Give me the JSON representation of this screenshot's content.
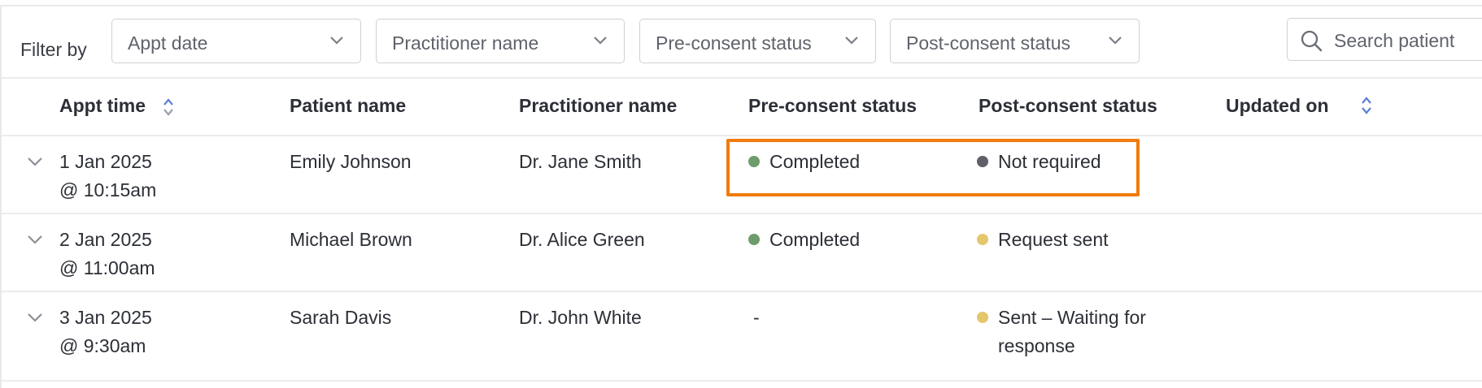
{
  "filter_bar": {
    "label": "Filter by",
    "dropdowns": [
      {
        "label": "Appt date"
      },
      {
        "label": "Practitioner name"
      },
      {
        "label": "Pre-consent status"
      },
      {
        "label": "Post-consent status"
      }
    ],
    "search": {
      "placeholder": "Search patient"
    }
  },
  "table": {
    "columns": [
      "Appt time",
      "Patient name",
      "Practitioner name",
      "Pre-consent status",
      "Post-consent status",
      "Updated on"
    ],
    "rows": [
      {
        "date": "1 Jan 2025",
        "time": "@ 10:15am",
        "patient": "Emily Johnson",
        "practitioner": "Dr. Jane Smith",
        "pre_status": "Completed",
        "pre_color": "#6e9c6b",
        "post_status": "Not required",
        "post_status_line2": "",
        "post_color": "#5f6068"
      },
      {
        "date": "2 Jan 2025",
        "time": "@ 11:00am",
        "patient": "Michael Brown",
        "practitioner": "Dr. Alice Green",
        "pre_status": "Completed",
        "pre_color": "#6e9c6b",
        "post_status": "Request sent",
        "post_status_line2": "",
        "post_color": "#e5c66d"
      },
      {
        "date": "3 Jan 2025",
        "time": "@ 9:30am",
        "patient": "Sarah Davis",
        "practitioner": "Dr. John White",
        "pre_status": "-",
        "pre_color": "",
        "post_status": "Sent – Waiting for",
        "post_status_line2": "response",
        "post_color": "#e5c66d"
      }
    ]
  },
  "colors": {
    "highlight": "#f27b0c",
    "sort_icon": "#5b7fd6",
    "border": "#cfd1d6"
  }
}
